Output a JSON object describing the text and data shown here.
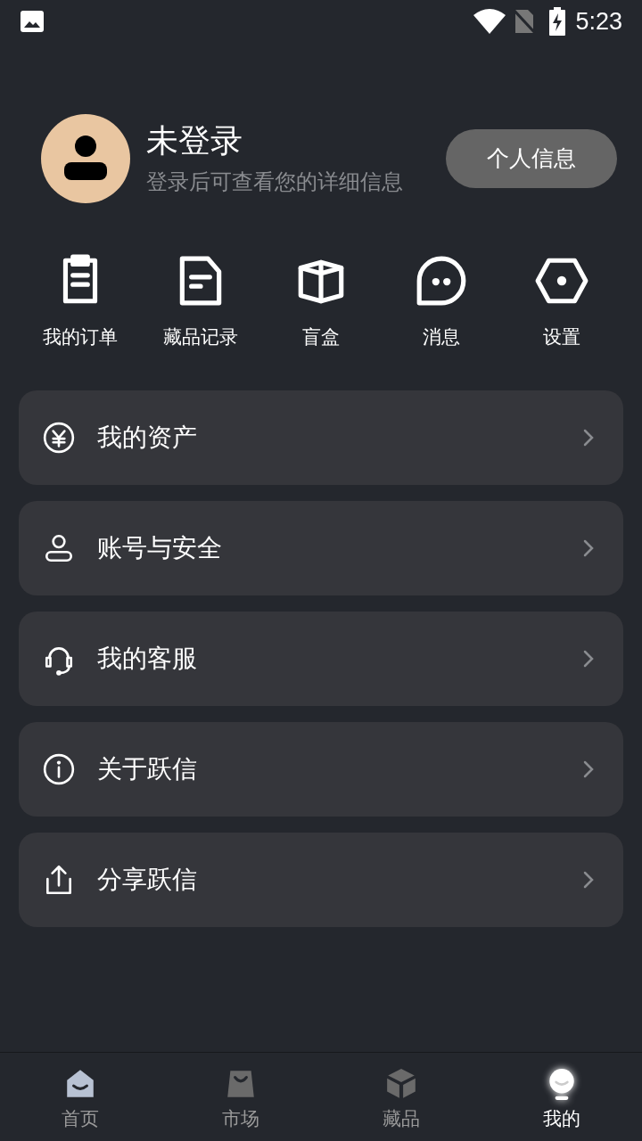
{
  "status_bar": {
    "time": "5:23"
  },
  "profile": {
    "name": "未登录",
    "subtitle": "登录后可查看您的详细信息",
    "button": "个人信息"
  },
  "quick_actions": [
    {
      "label": "我的订单"
    },
    {
      "label": "藏品记录"
    },
    {
      "label": "盲盒"
    },
    {
      "label": "消息"
    },
    {
      "label": "设置"
    }
  ],
  "menu": [
    {
      "label": "我的资产"
    },
    {
      "label": "账号与安全"
    },
    {
      "label": "我的客服"
    },
    {
      "label": "关于跃信"
    },
    {
      "label": "分享跃信"
    }
  ],
  "bottom_nav": [
    {
      "label": "首页",
      "selected": false
    },
    {
      "label": "市场",
      "selected": false
    },
    {
      "label": "藏品",
      "selected": false
    },
    {
      "label": "我的",
      "selected": true
    }
  ]
}
